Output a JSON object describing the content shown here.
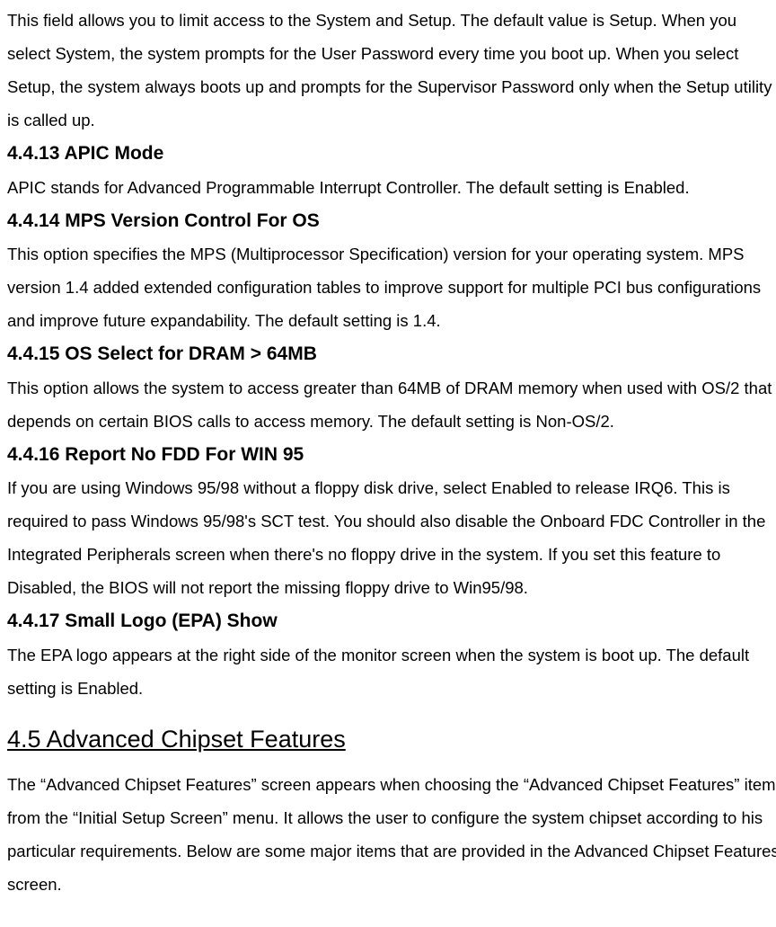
{
  "intro_p1": "This field allows you to limit access to the System and Setup. The default value is Setup. When you select System, the system prompts for the User Password every time you boot up. When you select Setup, the system always boots up and prompts for the Supervisor Password only when the Setup utility is called up.",
  "sections": {
    "s4413": {
      "title": "4.4.13 APIC Mode",
      "body": "APIC stands for Advanced Programmable Interrupt Controller. The default setting is Enabled."
    },
    "s4414": {
      "title": "4.4.14 MPS Version Control For OS",
      "body": "This option specifies the MPS (Multiprocessor Specification) version for your operating system. MPS version 1.4 added extended configuration tables to improve support for multiple PCI bus configurations and improve future expandability. The default setting is 1.4."
    },
    "s4415": {
      "title": "4.4.15 OS Select for DRAM > 64MB",
      "body": "This option allows the system to access greater than 64MB of DRAM memory when used with OS/2 that depends on certain BIOS calls to access memory. The default setting is Non-OS/2."
    },
    "s4416": {
      "title": "4.4.16 Report No FDD For WIN 95",
      "body": "If you are using Windows 95/98 without a floppy disk drive, select Enabled to release IRQ6. This is required to pass Windows 95/98's SCT test. You should also disable the Onboard FDC Controller in the Integrated Peripherals screen when there's no floppy drive in the system. If you set this feature to Disabled, the BIOS will not report the missing floppy drive to Win95/98."
    },
    "s4417": {
      "title": "4.4.17 Small Logo (EPA) Show",
      "body": "The EPA logo appears at the right side of the monitor screen when the system is boot up. The default setting is Enabled."
    }
  },
  "s45": {
    "title": "4.5 Advanced Chipset Features",
    "body": "The “Advanced Chipset Features” screen appears when choosing the “Advanced Chipset Features” item from the “Initial Setup Screen” menu. It allows the user to configure the system chipset according to his particular requirements. Below are some major items that are provided in the Advanced Chipset Features screen."
  }
}
